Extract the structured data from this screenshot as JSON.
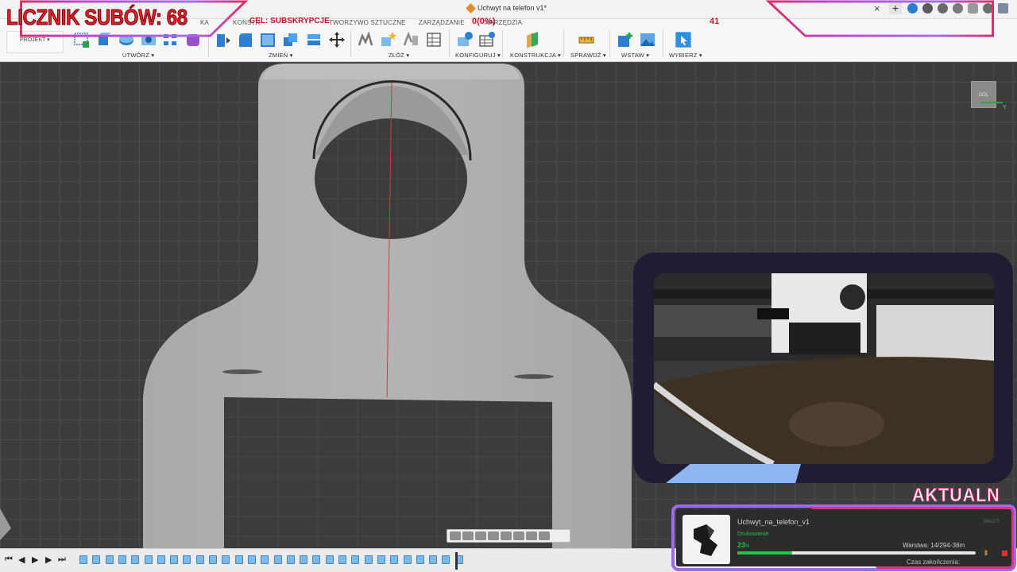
{
  "app": {
    "document_title": "Uchwyt na telefon v1*",
    "close_glyph": "×",
    "new_tab_glyph": "+"
  },
  "ribbon": {
    "tabs": [
      "KA",
      "KONSTR",
      "TWORZYWO SZTUCZNE",
      "ZARZĄDZANIE",
      "NARZĘDZIA"
    ],
    "project_label": "PROJEKT ▾",
    "groups": [
      "UTWÓRZ ▾",
      "ZMIEŃ ▾",
      "ZŁÓŻ ▾",
      "KONFIGURUJ ▾",
      "KONSTRUKCJA ▾",
      "SPRAWDŹ ▾",
      "WSTAW ▾",
      "WYBIERZ ▾"
    ]
  },
  "viewcube": {
    "label": "DÓŁ",
    "axis_label": "Y"
  },
  "overlay": {
    "subs_counter": "LICZNIK SUBÓW: 68",
    "goal_label": "CEL: SUBSKRYPCJE",
    "goal_progress": "0(0%)",
    "goal_total": "41",
    "aktual_label": "AKTUALN"
  },
  "printer": {
    "job_name": "Uchwyt_na_telefon_v1",
    "status": "Drukowanie",
    "code": "80e27t",
    "progress_percent": "23",
    "progress_unit": "%",
    "progress_fraction": 0.23,
    "layer": "Warstwa: 14/294",
    "remaining": "-38m",
    "finish_label": "Czas zakończenia:",
    "pause_glyph": "II"
  },
  "colors": {
    "accent_red": "#e02028",
    "status_green": "#20c24a",
    "frame_purple": "#9b6cf0",
    "frame_pink": "#e0327f"
  },
  "timeline": {
    "controls": [
      "⏮",
      "◀",
      "▶",
      "▶",
      "⏭"
    ]
  }
}
